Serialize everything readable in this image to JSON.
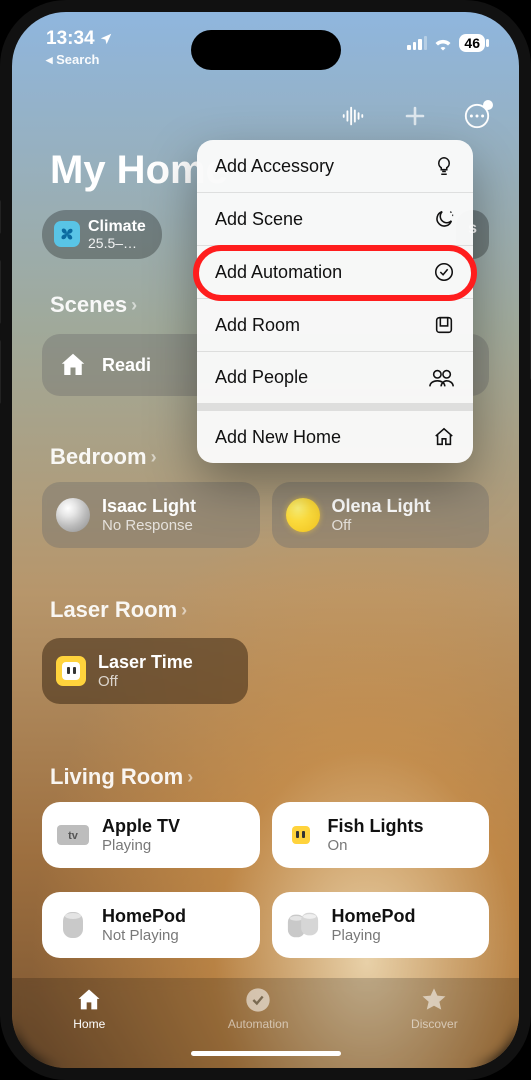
{
  "status": {
    "time": "13:34",
    "back_label": "Search",
    "battery": "46"
  },
  "header": {
    "title": "My Home"
  },
  "chips": {
    "climate": {
      "label": "Climate",
      "value": "25.5–…"
    },
    "right_peek": "s"
  },
  "sections": {
    "scenes": "Scenes",
    "bedroom": "Bedroom",
    "laser": "Laser Room",
    "living": "Living Room"
  },
  "scenes": {
    "item0": {
      "title": "Readi"
    }
  },
  "bedroom": {
    "item0": {
      "title": "Isaac Light",
      "sub": "No Response"
    },
    "item1": {
      "title": "Olena Light",
      "sub": "Off"
    }
  },
  "laser": {
    "item0": {
      "title": "Laser Time",
      "sub": "Off"
    }
  },
  "living": {
    "item0": {
      "title": "Apple TV",
      "sub": "Playing"
    },
    "item1": {
      "title": "Fish Lights",
      "sub": "On"
    },
    "item2": {
      "title": "HomePod",
      "sub": "Not Playing"
    },
    "item3": {
      "title": "HomePod",
      "sub": "Playing"
    }
  },
  "popup": {
    "add_accessory": "Add Accessory",
    "add_scene": "Add Scene",
    "add_automation": "Add Automation",
    "add_room": "Add Room",
    "add_people": "Add People",
    "add_home": "Add New Home"
  },
  "tabs": {
    "home": "Home",
    "automation": "Automation",
    "discover": "Discover"
  }
}
